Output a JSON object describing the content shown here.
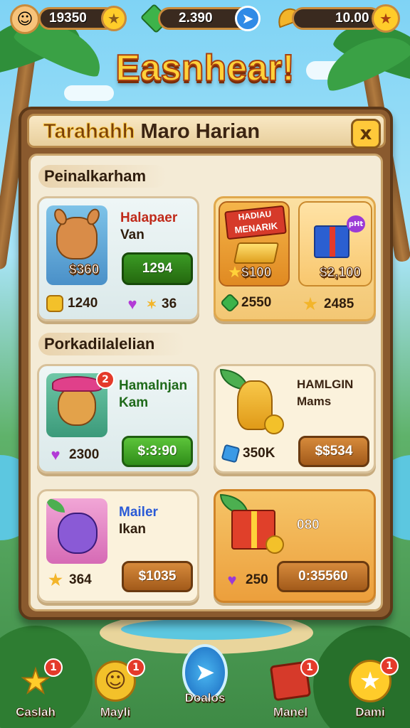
{
  "top_bar": {
    "player_score": "19350",
    "gems": "2.390",
    "coins": "10.00"
  },
  "game_title": "Easnhear!",
  "panel": {
    "title_part1": "Tarahahh",
    "title_part2": "Maro Harian",
    "close_icon": "x"
  },
  "sections": [
    {
      "label": "Peinalkarham"
    },
    {
      "label": "Porkadilalelian"
    }
  ],
  "cards": [
    {
      "title_line1": "Halapaer",
      "title_line2": "Van",
      "overlay_price": "$360",
      "button": "1294",
      "stat1": "1240",
      "stat1_icon": "coin-icon",
      "stat2": "36",
      "stat2_icon": "heart-icon"
    },
    {
      "banner_line1": "HADIAU",
      "banner_line2": "MENARIK",
      "overlay_price": "$100",
      "stat1": "2550",
      "stat1_icon": "gem-icon"
    },
    {
      "gift_tag": "pHt",
      "overlay_price": "$2,100",
      "stat1": "2485",
      "stat1_icon": "star-icon"
    },
    {
      "title_line1": "Hamalnjan",
      "title_line2": "Kam",
      "badge": "2",
      "stat1": "2300",
      "stat1_icon": "heart-icon",
      "button": "$:3:90"
    },
    {
      "title_line1": "HAMLGIN",
      "title_line2": "Mams",
      "stat1": "350K",
      "stat1_icon": "gem-icon",
      "button": "$$534"
    },
    {
      "title_line1": "Mailer",
      "title_line2": "Ikan",
      "stat1": "364",
      "stat1_icon": "star-icon",
      "button": "$1035"
    },
    {
      "tag": "080",
      "stat1": "250",
      "stat1_icon": "heart-icon",
      "button": "0:35560"
    }
  ],
  "bottom_nav": [
    {
      "label": "Caslah",
      "icon": "star-icon",
      "badge": "1"
    },
    {
      "label": "Mayli",
      "icon": "face-icon",
      "badge": "1"
    },
    {
      "label": "Doalos",
      "icon": "compass-icon",
      "badge": ""
    },
    {
      "label": "Manel",
      "icon": "chest-icon",
      "badge": "1"
    },
    {
      "label": "Dami",
      "icon": "star-coin-icon",
      "badge": "1"
    }
  ],
  "colors": {
    "title": "#ffd23a",
    "panel_wood": "#8a5a2e",
    "panel_paper": "#f4ebd6",
    "button_green": "#2f8d19",
    "button_brown": "#a25a1a",
    "badge_red": "#e43a2a"
  }
}
